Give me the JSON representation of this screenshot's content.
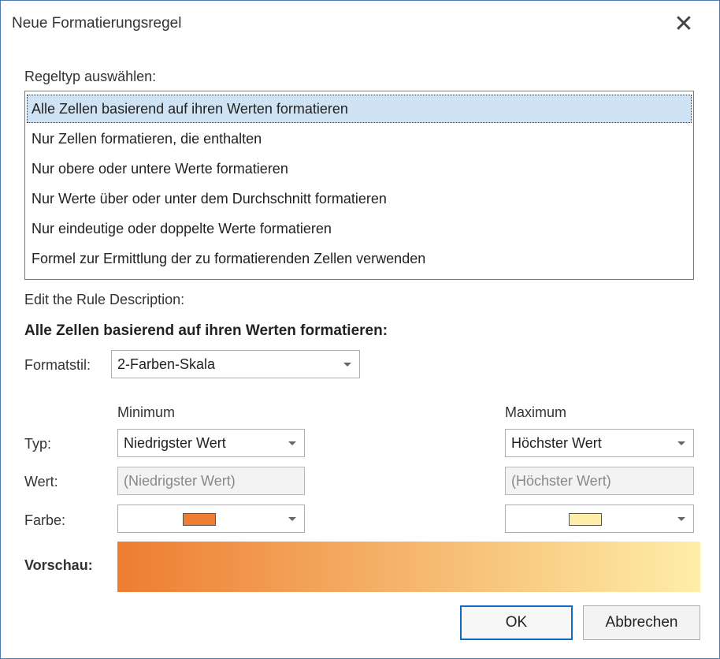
{
  "dialog": {
    "title": "Neue Formatierungsregel"
  },
  "rule_type": {
    "label": "Regeltyp auswählen:",
    "selected_index": 0,
    "items": [
      "Alle Zellen basierend auf ihren Werten formatieren",
      "Nur Zellen formatieren, die enthalten",
      "Nur obere oder untere Werte formatieren",
      "Nur Werte über oder unter dem Durchschnitt formatieren",
      "Nur eindeutige oder doppelte Werte formatieren",
      "Formel zur Ermittlung der zu formatierenden Zellen verwenden"
    ]
  },
  "description": {
    "label": "Edit the Rule Description:",
    "heading": "Alle Zellen basierend auf ihren Werten formatieren:",
    "format_style_label": "Formatstil:",
    "format_style_value": "2-Farben-Skala"
  },
  "minimum": {
    "header": "Minimum",
    "type": "Niedrigster Wert",
    "value": "(Niedrigster Wert)",
    "color": "#ed7d31"
  },
  "maximum": {
    "header": "Maximum",
    "type": "Höchster Wert",
    "value": "(Höchster Wert)",
    "color": "#feeea8"
  },
  "row_labels": {
    "type": "Typ:",
    "value": "Wert:",
    "color": "Farbe:"
  },
  "preview_label": "Vorschau:",
  "buttons": {
    "ok": "OK",
    "cancel": "Abbrechen"
  }
}
